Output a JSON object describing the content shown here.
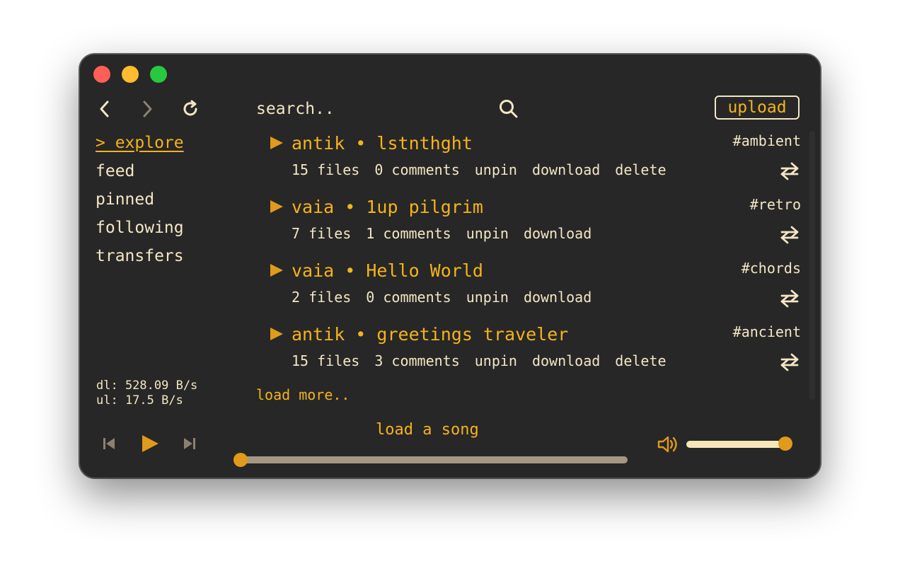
{
  "window": {
    "buttons": [
      "close",
      "minimize",
      "zoom"
    ],
    "colors": {
      "background": "#272727",
      "accent": "#f5b31c",
      "text": "#f3e6c4"
    }
  },
  "toolbar": {
    "back_icon": "chevron-left-icon",
    "forward_icon": "chevron-right-icon",
    "refresh_icon": "refresh-icon",
    "search_placeholder": "search..",
    "search_icon": "search-icon",
    "upload_label": "upload"
  },
  "sidebar": {
    "items": [
      {
        "label": "> explore",
        "active": true
      },
      {
        "label": "feed",
        "active": false
      },
      {
        "label": "pinned",
        "active": false
      },
      {
        "label": "following",
        "active": false
      },
      {
        "label": "transfers",
        "active": false
      }
    ],
    "download_rate": "dl: 528.09 B/s",
    "upload_rate": "ul: 17.5 B/s"
  },
  "feed": {
    "posts": [
      {
        "title": "antik • lstnthght",
        "tag": "#ambient",
        "files": "15 files",
        "comments": "0 comments",
        "unpin": "unpin",
        "download": "download",
        "delete": "delete"
      },
      {
        "title": "vaia • 1up pilgrim",
        "tag": "#retro",
        "files": "7 files",
        "comments": "1 comments",
        "unpin": "unpin",
        "download": "download"
      },
      {
        "title": "vaia • Hello World",
        "tag": "#chords",
        "files": "2 files",
        "comments": "0 comments",
        "unpin": "unpin",
        "download": "download"
      },
      {
        "title": "antik • greetings traveler",
        "tag": "#ancient",
        "files": "15 files",
        "comments": "3 comments",
        "unpin": "unpin",
        "download": "download",
        "delete": "delete"
      }
    ],
    "load_more": "load more.."
  },
  "player": {
    "song_label": "load a song",
    "progress": 0.0,
    "volume": 1.0,
    "prev_icon": "skip-back-icon",
    "play_icon": "play-icon",
    "next_icon": "skip-forward-icon",
    "volume_icon": "volume-icon"
  }
}
